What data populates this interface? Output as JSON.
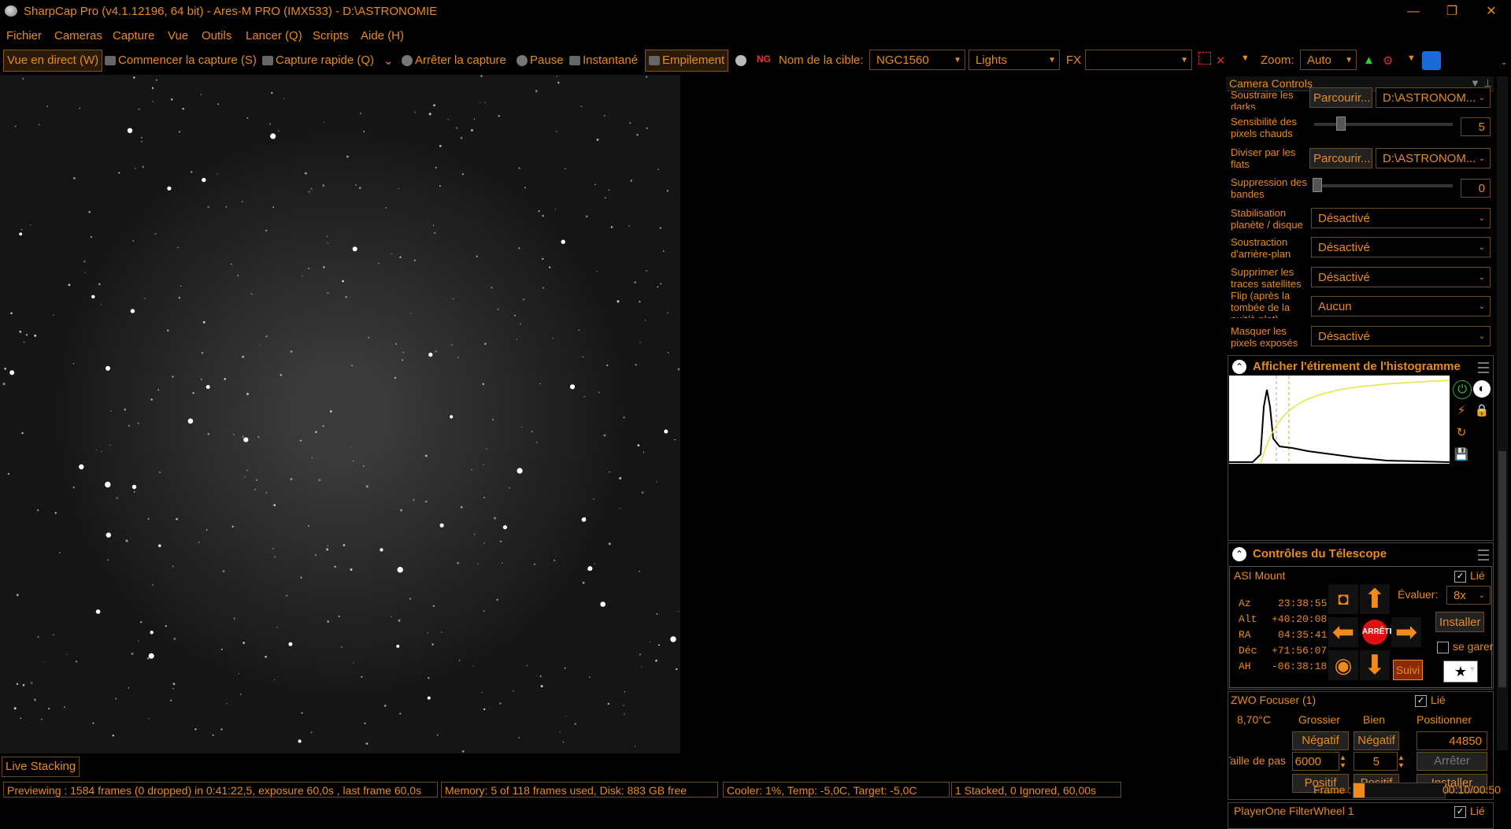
{
  "title": "SharpCap Pro (v4.1.12196, 64 bit) - Ares-M PRO (IMX533) - D:\\ASTRONOMIE",
  "window_controls": {
    "minimize": "—",
    "restore": "❐",
    "close": "✕"
  },
  "menu": [
    "Fichier",
    "Cameras",
    "Capture",
    "Vue",
    "Outils",
    "Lancer (Q)",
    "Scripts",
    "Aide (H)"
  ],
  "toolbar": {
    "live_view": "Vue en direct (W)",
    "start_capture": "Commencer la capture (S)",
    "quick_capture": "Capture rapide (Q)",
    "stop_capture": "Arrêter la capture",
    "pause": "Pause",
    "snapshot": "Instantané",
    "stacking": "Empilement",
    "target_label": "Nom de la cible:",
    "target_value": "NGC1560",
    "frame_type": "Lights",
    "fx_label": "FX",
    "fx_value": "",
    "zoom_label": "Zoom:",
    "zoom_value": "Auto"
  },
  "panel": {
    "title": "Camera Controls",
    "rows": {
      "darks_label": "Soustraire les darks",
      "darks_browse": "Parcourir...",
      "darks_path": "D:\\ASTRONOM...",
      "hotpix_label": "Sensibilité des pixels chauds",
      "hotpix_value": "5",
      "flats_label": "Diviser par les flats",
      "flats_browse": "Parcourir...",
      "flats_path": "D:\\ASTRONOM...",
      "banding_label": "Suppression des bandes",
      "banding_value": "0",
      "stab_label": "Stabilisation planète / disque",
      "stab_value": "Désactivé",
      "bg_label": "Soustraction d'arrière-plan",
      "bg_value": "Désactivé",
      "sat_label": "Supprimer les traces satellites",
      "sat_value": "Désactivé",
      "flip_label": "Flip (après la tombée de la nuit/à plat)",
      "flip_value": "Aucun",
      "mask_label": "Masquer les pixels exposés",
      "mask_value": "Désactivé"
    },
    "histogram_title": "Afficher l'étirement de l'histogramme",
    "telescope_title": "Contrôles du Télescope",
    "mount": {
      "name": "ASI Mount",
      "linked": "Lié",
      "rows": [
        {
          "k": "Az",
          "v": "23:38:55"
        },
        {
          "k": "Alt",
          "v": "+40:20:08"
        },
        {
          "k": "RA",
          "v": "04:35:41"
        },
        {
          "k": "Déc",
          "v": "+71:56:07"
        },
        {
          "k": "AH",
          "v": "-06:38:18"
        }
      ],
      "stop": "ARRÊTE",
      "rate_label": "Évaluer:",
      "rate_value": "8x",
      "install": "Installer",
      "park": "se garer",
      "tracking": "Suivi"
    },
    "focuser": {
      "name": "ZWO Focuser (1)",
      "linked": "Lié",
      "temp": "8,70°C",
      "coarse": "Grossier",
      "fine": "Bien",
      "positioner": "Positionner",
      "neg1": "Négatif",
      "neg2": "Négatif",
      "position": "44850",
      "step_label": "Taille de pas",
      "step_coarse": "6000",
      "step_fine": "5",
      "stop": "Arrêter",
      "pos1": "Positif",
      "pos2": "Positif",
      "install": "Installer"
    },
    "filterwheel": {
      "name": "PlayerOne FilterWheel 1",
      "linked": "Lié"
    }
  },
  "live_stacking_tab": "Live Stacking",
  "status": {
    "preview": "Previewing : 1584 frames (0 dropped) in 0:41:22,5, exposure 60,0s , last frame 60,0s",
    "memory": "Memory: 5 of 118 frames used, Disk: 883 GB free",
    "cooler": "Cooler: 1%, Temp: -5,0C, Target: -5,0C",
    "stacked": "1 Stacked, 0 Ignored, 60,00s",
    "frame_label": "Frame :",
    "frame_progress": 0.12,
    "time": "00:10/00:50"
  },
  "colors": {
    "accent": "#e88a1f",
    "bg": "#000000"
  }
}
